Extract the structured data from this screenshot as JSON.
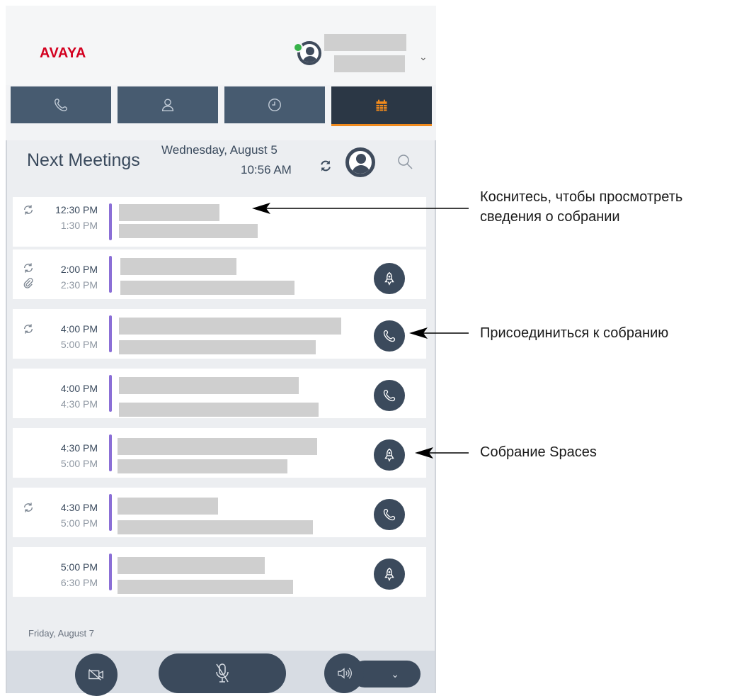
{
  "header": {
    "logo": "AVAYA",
    "account": {
      "presence": "available"
    }
  },
  "tabs": [
    {
      "icon": "phone-icon",
      "active": false
    },
    {
      "icon": "contacts-icon",
      "active": false
    },
    {
      "icon": "history-icon",
      "active": false
    },
    {
      "icon": "calendar-icon",
      "active": true
    }
  ],
  "colors": {
    "accent": "#f08a1d",
    "tab_bg": "#475b70",
    "meeting_bar": "#8b6fd6",
    "logo": "#d3001f"
  },
  "panel": {
    "title": "Next Meetings",
    "date": "Wednesday, August 5",
    "time": "10:56 AM"
  },
  "meetings": [
    {
      "start": "12:30 PM",
      "end": "1:30 PM",
      "recurring": true,
      "attachment": false,
      "action": "none"
    },
    {
      "start": "2:00 PM",
      "end": "2:30 PM",
      "recurring": true,
      "attachment": true,
      "action": "spaces"
    },
    {
      "start": "4:00 PM",
      "end": "5:00 PM",
      "recurring": true,
      "attachment": false,
      "action": "call"
    },
    {
      "start": "4:00 PM",
      "end": "4:30 PM",
      "recurring": false,
      "attachment": false,
      "action": "call"
    },
    {
      "start": "4:30 PM",
      "end": "5:00 PM",
      "recurring": false,
      "attachment": false,
      "action": "spaces"
    },
    {
      "start": "4:30 PM",
      "end": "5:00 PM",
      "recurring": true,
      "attachment": false,
      "action": "call"
    },
    {
      "start": "5:00 PM",
      "end": "6:30 PM",
      "recurring": false,
      "attachment": false,
      "action": "spaces"
    }
  ],
  "next_day": "Friday, August 7",
  "callouts": {
    "details_line1": "Коснитесь, чтобы просмотреть",
    "details_line2": "сведения о собрании",
    "join": "Присоединиться к собранию",
    "spaces": "Собрание Spaces"
  }
}
